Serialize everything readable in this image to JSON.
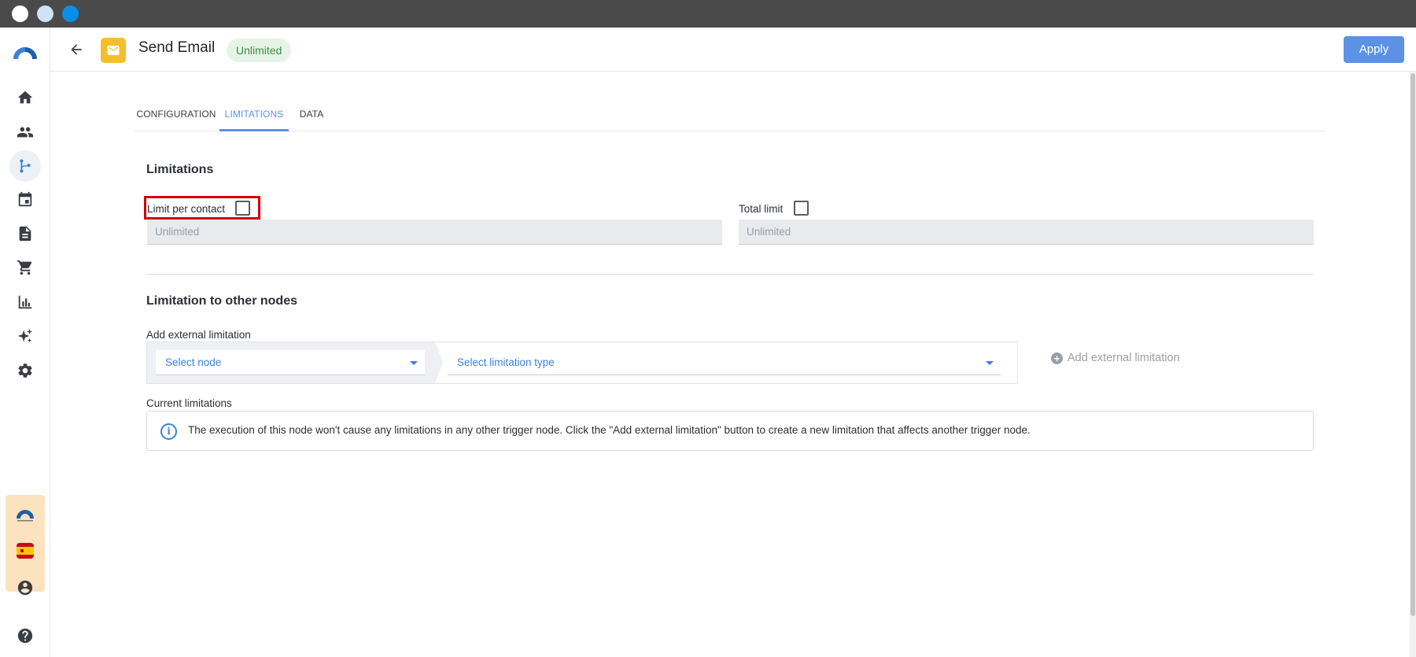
{
  "header": {
    "title": "Send Email",
    "status_badge": "Unlimited",
    "apply_label": "Apply",
    "node_icon": "email-icon"
  },
  "sidebar": {
    "items": [
      {
        "name": "home",
        "icon": "home-icon"
      },
      {
        "name": "contacts",
        "icon": "people-icon"
      },
      {
        "name": "automation",
        "icon": "flow-icon",
        "active": true
      },
      {
        "name": "calendar",
        "icon": "calendar-icon"
      },
      {
        "name": "documents",
        "icon": "document-icon"
      },
      {
        "name": "shop",
        "icon": "cart-icon"
      },
      {
        "name": "reports",
        "icon": "bar-chart-icon"
      },
      {
        "name": "ai",
        "icon": "sparkle-icon"
      },
      {
        "name": "settings",
        "icon": "gear-icon"
      }
    ],
    "account_icon": "account-icon",
    "help_icon": "help-icon"
  },
  "tabs": [
    {
      "label": "CONFIGURATION",
      "active": false
    },
    {
      "label": "LIMITATIONS",
      "active": true
    },
    {
      "label": "DATA",
      "active": false
    }
  ],
  "limitations": {
    "title": "Limitations",
    "per_contact": {
      "label": "Limit per contact",
      "checked": false,
      "placeholder": "Unlimited"
    },
    "total": {
      "label": "Total limit",
      "checked": false,
      "placeholder": "Unlimited"
    }
  },
  "other_nodes": {
    "title": "Limitation to other nodes",
    "add_label": "Add external limitation",
    "select_node": "Select node",
    "select_type": "Select limitation type",
    "add_button": "Add external limitation",
    "current_label": "Current limitations",
    "info_text": "The execution of this node won't cause any limitations in any other trigger node. Click the \"Add external limitation\" button to create a new limitation that affects another trigger node."
  },
  "colors": {
    "accent": "#5b92e5",
    "badge_bg": "#e6f4e8",
    "badge_text": "#3f8c44",
    "node_icon_bg": "#f6be2c",
    "highlight": "#d40000"
  }
}
